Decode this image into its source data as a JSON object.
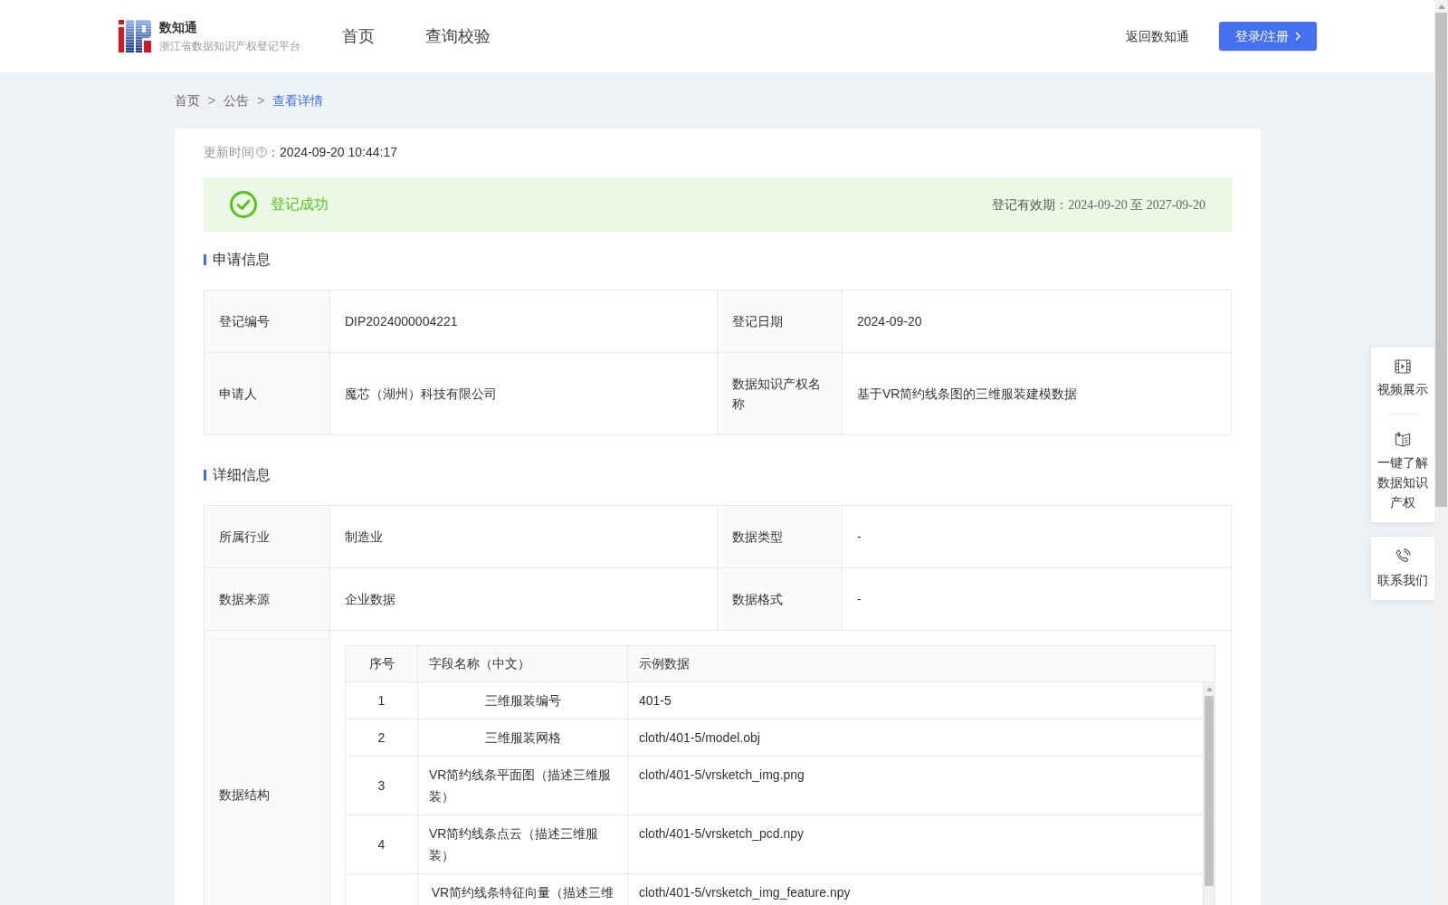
{
  "header": {
    "logo": {
      "title": "数知通",
      "subtitle": "浙江省数据知识产权登记平台"
    },
    "nav": [
      {
        "label": "首页",
        "selected": false
      },
      {
        "label": "查询校验",
        "selected": false
      }
    ],
    "back_link": "返回数知通",
    "login_button": "登录/注册"
  },
  "breadcrumb": [
    {
      "label": "首页",
      "current": false
    },
    {
      "separator": ">",
      "label": "公告",
      "current": false
    },
    {
      "separator": ">",
      "label": "查看详情",
      "current": true
    }
  ],
  "update_time": {
    "label": "更新时间",
    "colon": "：",
    "value": "2024-09-20 10:44:17"
  },
  "status_banner": {
    "label": "登记成功",
    "validity_label": "登记有效期：",
    "validity_value": "2024-09-20 至 2027-09-20"
  },
  "sections": [
    {
      "title": "申请信息",
      "rows": [
        {
          "kind": "pair",
          "fields": [
            {
              "label": "登记编号",
              "value": "DIP2024000004221"
            },
            {
              "label": "登记日期",
              "value": "2024-09-20"
            }
          ]
        },
        {
          "kind": "pair",
          "fields": [
            {
              "label": "申请人",
              "value": "魔芯（湖州）科技有限公司"
            },
            {
              "label": "数据知识产权名称",
              "value": "基于VR简约线条图的三维服装建模数据"
            }
          ]
        }
      ]
    },
    {
      "title": "详细信息",
      "rows": [
        {
          "kind": "pair",
          "fields": [
            {
              "label": "所属行业",
              "value": "制造业"
            },
            {
              "label": "数据类型",
              "value": "-"
            }
          ]
        },
        {
          "kind": "pair",
          "fields": [
            {
              "label": "数据来源",
              "value": "企业数据"
            },
            {
              "label": "数据格式",
              "value": "-"
            }
          ]
        },
        {
          "kind": "table",
          "label": "数据结构",
          "table": {
            "columns": [
              "序号",
              "字段名称（中文）",
              "示例数据"
            ],
            "rows": [
              {
                "index": "1",
                "field_name": "三维服装编号",
                "example": "401-5"
              },
              {
                "index": "2",
                "field_name": "三维服装网格",
                "example": "cloth/401-5/model.obj"
              },
              {
                "index": "3",
                "field_name": "VR简约线条平面图（描述三维服装）",
                "example": "cloth/401-5/vrsketch_img.png"
              },
              {
                "index": "4",
                "field_name": "VR简约线条点云（描述三维服装）",
                "example": "cloth/401-5/vrsketch_pcd.npy"
              },
              {
                "field_name": "VR简约线条特征向量（描述三维",
                "example": "cloth/401-5/vrsketch_img_feature.npy"
              }
            ]
          }
        }
      ]
    }
  ],
  "side_panel": [
    {
      "items": [
        {
          "kind": "video",
          "label": "视频展示"
        },
        {
          "kind": "guide",
          "label": "一键了解数据知识产权"
        }
      ]
    },
    {
      "items": [
        {
          "kind": "contact",
          "label": "联系我们"
        }
      ]
    }
  ]
}
